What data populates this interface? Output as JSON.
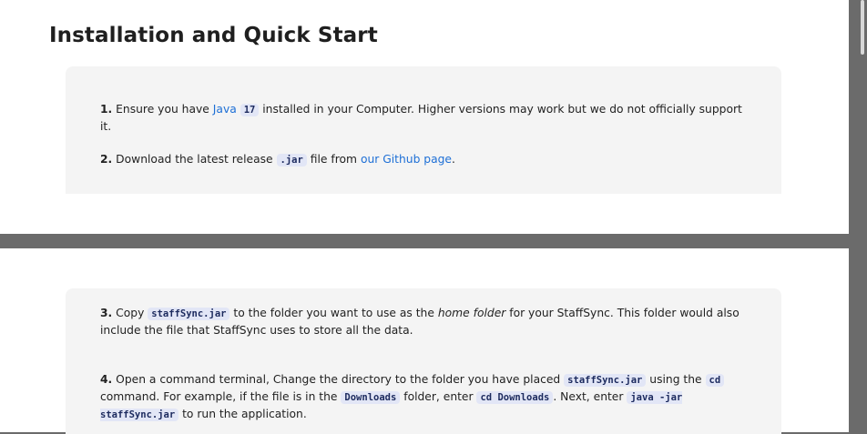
{
  "title": "Installation and Quick Start",
  "step1": {
    "num": "1.",
    "t1": "Ensure you have",
    "java_link": "Java",
    "java_version": "17",
    "t2": "installed in your Computer. Higher versions may work but we do not officially support it."
  },
  "step2": {
    "num": "2.",
    "t1": "Download the latest release",
    "jar": ".jar",
    "t2": "file from",
    "github_link": "our Github page",
    "t3": "."
  },
  "step3": {
    "num": "3.",
    "t1": "Copy",
    "jar_file": "staffSync.jar",
    "t2": "to the folder you want to use as the",
    "home_folder": "home folder",
    "t3": "for your StaffSync. This folder would also include the file that StaffSync uses to store all the data."
  },
  "step4": {
    "num": "4.",
    "t1": "Open a command terminal, Change the directory to the folder you have placed",
    "jar_file": "staffSync.jar",
    "t2": "using the",
    "cd_cmd": "cd",
    "t3": "command. For example, if the file is in the",
    "downloads": "Downloads",
    "t4": "folder, enter",
    "cd_downloads": "cd Downloads",
    "t5": ". Next, enter",
    "java_cmd": "java -jar staffSync.jar",
    "t6": "to run the application."
  }
}
